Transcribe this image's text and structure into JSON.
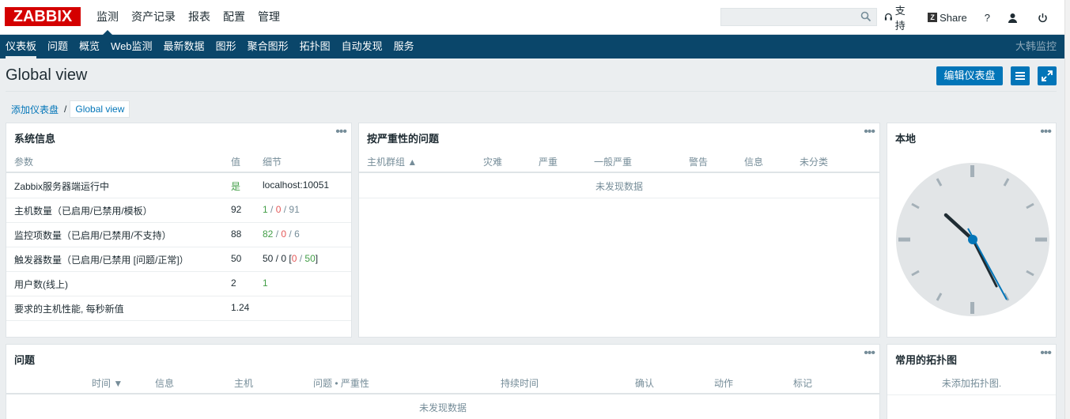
{
  "logo": "ZABBIX",
  "top_menu": [
    {
      "label": "监测",
      "active": true
    },
    {
      "label": "资产记录",
      "active": false
    },
    {
      "label": "报表",
      "active": false
    },
    {
      "label": "配置",
      "active": false
    },
    {
      "label": "管理",
      "active": false
    }
  ],
  "search": {
    "value": "",
    "placeholder": ""
  },
  "top_right": {
    "support": "支持",
    "share": "Share",
    "help": "?"
  },
  "sub_nav": {
    "items": [
      "仪表板",
      "问题",
      "概览",
      "Web监测",
      "最新数据",
      "图形",
      "聚合图形",
      "拓扑图",
      "自动发现",
      "服务"
    ],
    "active_index": 0,
    "brand": "大韩监控"
  },
  "page": {
    "title": "Global view",
    "edit_button": "编辑仪表盘",
    "breadcrumb": {
      "parent": "添加仪表盘",
      "separator": "/",
      "current": "Global view"
    }
  },
  "sysinfo": {
    "title": "系统信息",
    "headers": {
      "param": "参数",
      "value": "值",
      "detail": "细节"
    },
    "rows": [
      {
        "param": "Zabbix服务器端运行中",
        "value": "是",
        "detail": "localhost:10051"
      },
      {
        "param": "主机数量（已启用/已禁用/模板）",
        "value": "92",
        "d1": "1",
        "s1": " / ",
        "d2": "0",
        "s2": " / ",
        "d3": "91"
      },
      {
        "param": "监控项数量（已启用/已禁用/不支持）",
        "value": "88",
        "d1": "82",
        "s1": " / ",
        "d2": "0",
        "s2": " / ",
        "d3": "6"
      },
      {
        "param": "触发器数量（已启用/已禁用 [问题/正常]）",
        "value": "50",
        "t1": "50 / 0 [",
        "t2": "0",
        "t3": " / ",
        "t4": "50",
        "t5": "]"
      },
      {
        "param": "用户数(线上)",
        "value": "2",
        "d1": "1"
      },
      {
        "param": "要求的主机性能, 每秒新值",
        "value": "1.24"
      }
    ]
  },
  "severity": {
    "title": "按严重性的问题",
    "headers": [
      "主机群组 ▲",
      "灾难",
      "严重",
      "一般严重",
      "警告",
      "信息",
      "未分类"
    ],
    "empty": "未发现数据"
  },
  "clock": {
    "title": "本地"
  },
  "problems": {
    "title": "问题",
    "headers": [
      "时间 ▼",
      "信息",
      "主机",
      "问题 • 严重性",
      "持续时间",
      "确认",
      "动作",
      "标记"
    ],
    "empty": "未发现数据"
  },
  "maps": {
    "title": "常用的拓扑图",
    "empty": "未添加拓扑图."
  },
  "colors": {
    "brand_red": "#d40000",
    "nav_blue": "#0a466a",
    "button_blue": "#0275b8",
    "ok_green": "#429e47",
    "problem_red": "#e45959"
  },
  "widget_menu_icon": "ellipsis-icon"
}
